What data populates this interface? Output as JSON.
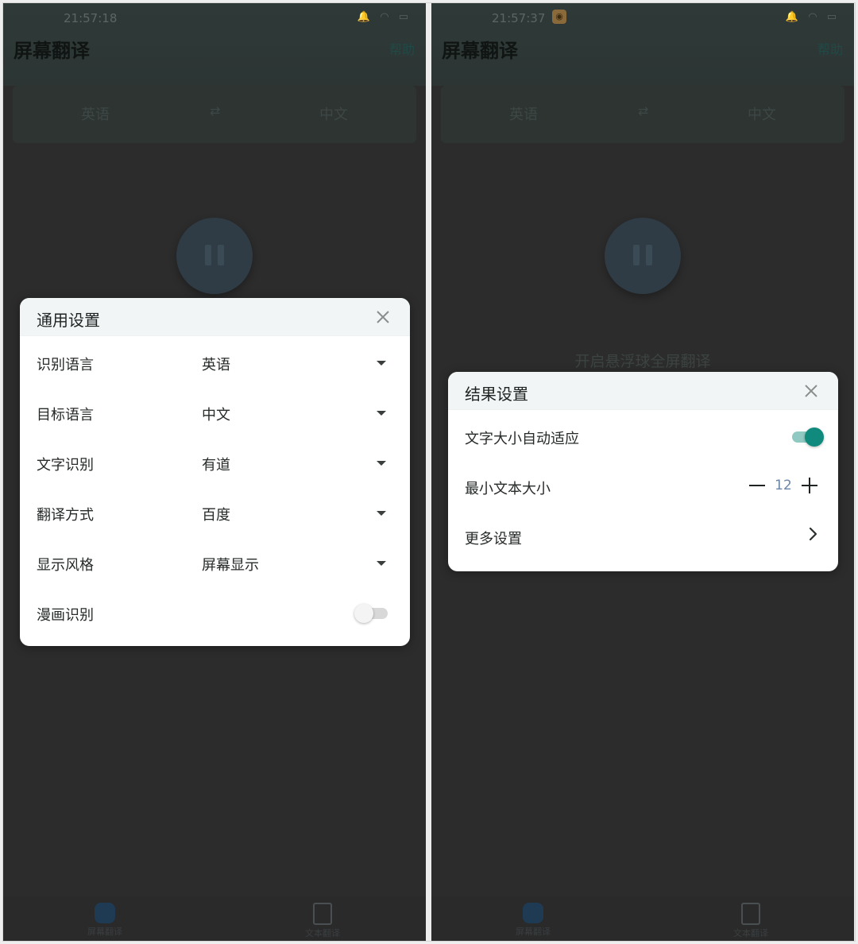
{
  "left_screen": {
    "status": {
      "time": "21:57:18"
    },
    "app": {
      "title": "屏幕翻译",
      "help": "帮助",
      "source_lang": "英语",
      "target_lang": "中文",
      "swap_symbol": "⇄"
    },
    "nav": {
      "home_label": "屏幕翻译",
      "text_label": "文本翻译"
    },
    "dialog": {
      "title": "通用设置",
      "rows": [
        {
          "label": "识别语言",
          "value": "英语"
        },
        {
          "label": "目标语言",
          "value": "中文"
        },
        {
          "label": "文字识别",
          "value": "有道"
        },
        {
          "label": "翻译方式",
          "value": "百度"
        },
        {
          "label": "显示风格",
          "value": "屏幕显示"
        }
      ],
      "comic_label": "漫画识别",
      "comic_enabled": false
    }
  },
  "right_screen": {
    "status": {
      "time": "21:57:37"
    },
    "app": {
      "title": "屏幕翻译",
      "help": "帮助",
      "source_lang": "英语",
      "target_lang": "中文",
      "swap_symbol": "⇄",
      "float_hint": "开启悬浮球全屏翻译"
    },
    "nav": {
      "home_label": "屏幕翻译",
      "text_label": "文本翻译"
    },
    "dialog": {
      "title": "结果设置",
      "auto_fit_label": "文字大小自动适应",
      "auto_fit_enabled": true,
      "min_size_label": "最小文本大小",
      "min_size_value": "12",
      "more_label": "更多设置"
    }
  },
  "colors": {
    "accent": "#0f8a7c",
    "stepper_value": "#6c85a8",
    "overlay": "#2c2c2c"
  }
}
